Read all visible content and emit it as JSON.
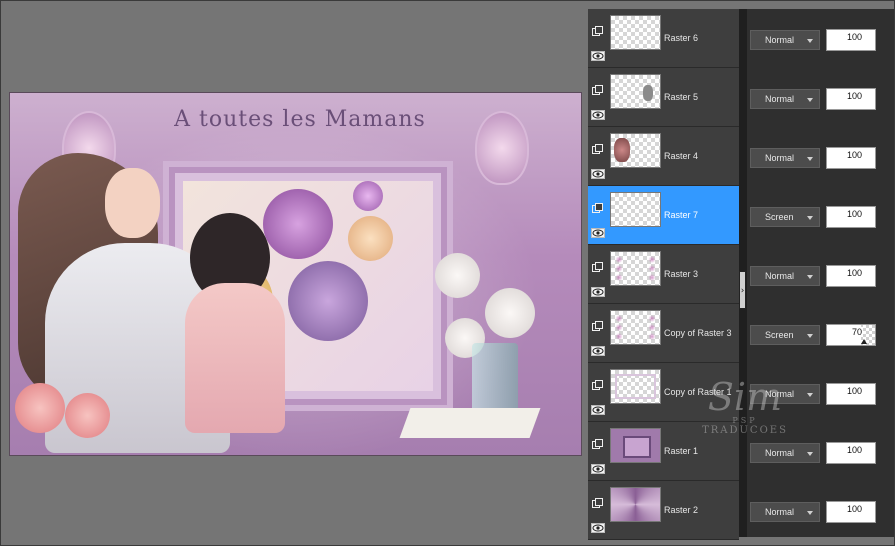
{
  "canvas": {
    "title": "A toutes les Mamans"
  },
  "layers": [
    {
      "name": "Raster 6",
      "blend": "Normal",
      "opacity": 100,
      "selected": false,
      "thumb": "transparent"
    },
    {
      "name": "Raster 5",
      "blend": "Normal",
      "opacity": 100,
      "selected": false,
      "thumb": "small-figure"
    },
    {
      "name": "Raster 4",
      "blend": "Normal",
      "opacity": 100,
      "selected": false,
      "thumb": "flower-figure"
    },
    {
      "name": "Raster 7",
      "blend": "Screen",
      "opacity": 100,
      "selected": true,
      "thumb": "transparent"
    },
    {
      "name": "Raster 3",
      "blend": "Normal",
      "opacity": 100,
      "selected": false,
      "thumb": "dots"
    },
    {
      "name": "Copy of Raster 3",
      "blend": "Screen",
      "opacity": 70,
      "selected": false,
      "thumb": "dots"
    },
    {
      "name": "Copy of Raster 1",
      "blend": "Normal",
      "opacity": 100,
      "selected": false,
      "thumb": "frame"
    },
    {
      "name": "Raster 1",
      "blend": "Normal",
      "opacity": 100,
      "selected": false,
      "thumb": "purple-frame"
    },
    {
      "name": "Raster 2",
      "blend": "Normal",
      "opacity": 100,
      "selected": false,
      "thumb": "purple-rays"
    }
  ],
  "watermark": {
    "initials": "Sim",
    "line1": "PSP",
    "line2": "TRADUCOES"
  },
  "colors": {
    "selected_row": "#3399ff",
    "panel_bg": "#3e3e3e",
    "workspace_bg": "#757575"
  }
}
